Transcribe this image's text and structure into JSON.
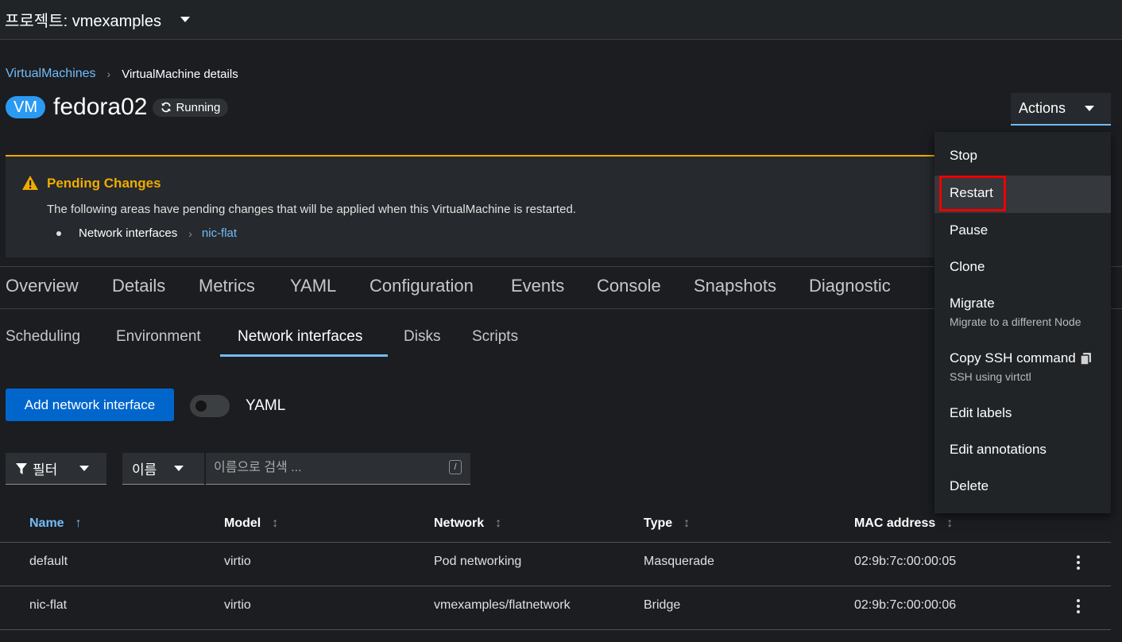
{
  "topbar": {
    "project_label": "프로젝트: vmexamples"
  },
  "breadcrumb": {
    "parent": "VirtualMachines",
    "current": "VirtualMachine details"
  },
  "header": {
    "badge": "VM",
    "name": "fedora02",
    "status": "Running",
    "actions_label": "Actions"
  },
  "alert": {
    "title": "Pending Changes",
    "description": "The following areas have pending changes that will be applied when this VirtualMachine is restarted.",
    "items": [
      {
        "label": "Network interfaces",
        "link": "nic-flat"
      }
    ]
  },
  "main_tabs": [
    "Overview",
    "Details",
    "Metrics",
    "YAML",
    "Configuration",
    "Events",
    "Console",
    "Snapshots",
    "Diagnostic"
  ],
  "sub_tabs": [
    "Scheduling",
    "Environment",
    "Network interfaces",
    "Disks",
    "Scripts"
  ],
  "sub_tabs_active": "Network interfaces",
  "toolbar": {
    "add_label": "Add network interface",
    "yaml_label": "YAML"
  },
  "filter": {
    "filter_label": "필터",
    "attribute_label": "이름",
    "search_placeholder": "이름으로 검색 ...",
    "shortcut": "/"
  },
  "table": {
    "columns": [
      "Name",
      "Model",
      "Network",
      "Type",
      "MAC address"
    ],
    "sorted_column": "Name",
    "rows": [
      [
        "default",
        "virtio",
        "Pod networking",
        "Masquerade",
        "02:9b:7c:00:00:05"
      ],
      [
        "nic-flat",
        "virtio",
        "vmexamples/flatnetwork",
        "Bridge",
        "02:9b:7c:00:00:06"
      ]
    ]
  },
  "actions_menu": {
    "items": [
      {
        "label": "Stop"
      },
      {
        "label": "Restart"
      },
      {
        "label": "Pause"
      },
      {
        "label": "Clone"
      },
      {
        "label": "Migrate",
        "description": "Migrate to a different Node"
      },
      {
        "label": "Copy SSH command",
        "description": "SSH using virtctl"
      },
      {
        "label": "Edit labels"
      },
      {
        "label": "Edit annotations"
      },
      {
        "label": "Delete"
      }
    ],
    "hovered": "Restart"
  },
  "colors": {
    "link": "#73bcf7",
    "warning": "#f0ab00",
    "primary": "#0066cc",
    "highlight": "#ee0000"
  }
}
